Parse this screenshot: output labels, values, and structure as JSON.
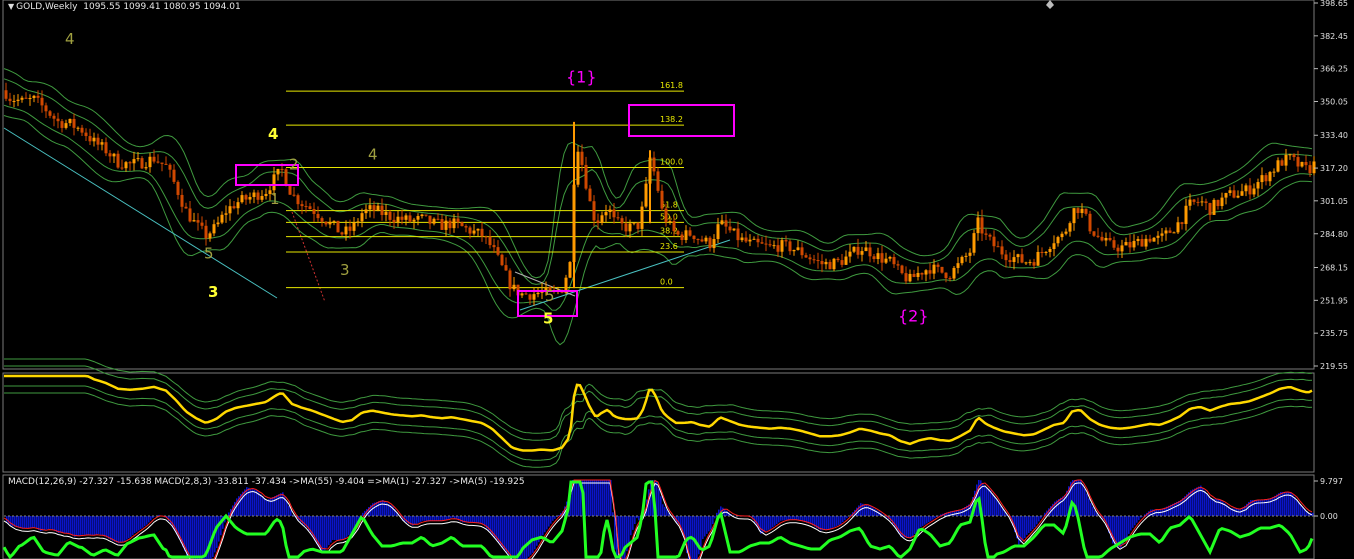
{
  "header": {
    "symbol": "GOLD,Weekly",
    "ohlc": "1095.55 1099.41 1080.95 1094.01"
  },
  "macd_header": {
    "text": "MACD(12,26,9) -27.327 -15.638  MACD(2,8,3) -33.811 -37.434  ->MA(55) -9.404  =>MA(1) -27.327  ->MA(5) -19.925"
  },
  "colors": {
    "background": "#000000",
    "candle_up": "#ff9a00",
    "candle_down": "#d04800",
    "band": "#3f9a3f",
    "fib": "#e8e800",
    "trendline": "#49c0c0",
    "highlight_box": "#ff00ff",
    "wave_yellow": "#ffff33",
    "wave_olive": "#a0a040",
    "wave_magenta": "#ff00ff",
    "osc_line": "#ffd800",
    "macd_hist": "#0a14c8",
    "macd_green": "#22ff22"
  },
  "chart_data": {
    "type": "candlestick",
    "timeframe": "Weekly",
    "price_axis": {
      "ticks": [
        "398.65",
        "382.45",
        "366.25",
        "350.05",
        "333.40",
        "317.20",
        "301.05",
        "284.80",
        "268.15",
        "251.95",
        "235.75",
        "219.55"
      ],
      "ylim": [
        219.55,
        398.65
      ]
    },
    "close_path_estimate": [
      [
        0,
        358
      ],
      [
        10,
        352
      ],
      [
        22,
        350
      ],
      [
        34,
        351
      ],
      [
        46,
        346
      ],
      [
        58,
        340
      ],
      [
        70,
        339
      ],
      [
        82,
        336
      ],
      [
        94,
        330
      ],
      [
        106,
        326
      ],
      [
        118,
        320
      ],
      [
        130,
        319
      ],
      [
        142,
        320
      ],
      [
        154,
        322
      ],
      [
        166,
        318
      ],
      [
        176,
        308
      ],
      [
        186,
        296
      ],
      [
        196,
        289
      ],
      [
        206,
        284
      ],
      [
        216,
        288
      ],
      [
        226,
        296
      ],
      [
        236,
        300
      ],
      [
        246,
        302
      ],
      [
        256,
        304
      ],
      [
        266,
        306
      ],
      [
        276,
        313
      ],
      [
        282,
        316
      ],
      [
        292,
        304
      ],
      [
        302,
        300
      ],
      [
        312,
        297
      ],
      [
        322,
        293
      ],
      [
        332,
        289
      ],
      [
        342,
        285
      ],
      [
        352,
        287
      ],
      [
        362,
        295
      ],
      [
        372,
        297
      ],
      [
        382,
        295
      ],
      [
        392,
        293
      ],
      [
        402,
        292
      ],
      [
        412,
        291
      ],
      [
        422,
        292
      ],
      [
        432,
        290
      ],
      [
        442,
        289
      ],
      [
        452,
        290
      ],
      [
        462,
        288
      ],
      [
        472,
        286
      ],
      [
        482,
        284
      ],
      [
        492,
        278
      ],
      [
        502,
        268
      ],
      [
        512,
        258
      ],
      [
        522,
        255
      ],
      [
        532,
        255
      ],
      [
        542,
        256
      ],
      [
        552,
        255
      ],
      [
        562,
        258
      ],
      [
        570,
        270
      ],
      [
        574,
        312
      ],
      [
        578,
        328
      ],
      [
        584,
        315
      ],
      [
        590,
        300
      ],
      [
        596,
        290
      ],
      [
        602,
        295
      ],
      [
        608,
        298
      ],
      [
        614,
        291
      ],
      [
        620,
        289
      ],
      [
        626,
        288
      ],
      [
        632,
        288
      ],
      [
        638,
        289
      ],
      [
        644,
        300
      ],
      [
        650,
        322
      ],
      [
        656,
        312
      ],
      [
        662,
        296
      ],
      [
        668,
        290
      ],
      [
        676,
        284
      ],
      [
        684,
        284
      ],
      [
        692,
        285
      ],
      [
        700,
        282
      ],
      [
        710,
        280
      ],
      [
        720,
        290
      ],
      [
        730,
        286
      ],
      [
        740,
        282
      ],
      [
        750,
        280
      ],
      [
        760,
        279
      ],
      [
        770,
        278
      ],
      [
        780,
        279
      ],
      [
        790,
        278
      ],
      [
        800,
        276
      ],
      [
        810,
        273
      ],
      [
        820,
        270
      ],
      [
        830,
        270
      ],
      [
        840,
        271
      ],
      [
        850,
        274
      ],
      [
        860,
        278
      ],
      [
        870,
        276
      ],
      [
        880,
        273
      ],
      [
        890,
        271
      ],
      [
        900,
        265
      ],
      [
        910,
        262
      ],
      [
        920,
        266
      ],
      [
        930,
        268
      ],
      [
        940,
        266
      ],
      [
        950,
        265
      ],
      [
        960,
        270
      ],
      [
        970,
        276
      ],
      [
        978,
        290
      ],
      [
        986,
        283
      ],
      [
        994,
        279
      ],
      [
        1004,
        275
      ],
      [
        1014,
        273
      ],
      [
        1024,
        271
      ],
      [
        1034,
        272
      ],
      [
        1044,
        277
      ],
      [
        1054,
        282
      ],
      [
        1064,
        284
      ],
      [
        1072,
        296
      ],
      [
        1080,
        298
      ],
      [
        1090,
        288
      ],
      [
        1100,
        282
      ],
      [
        1110,
        279
      ],
      [
        1120,
        278
      ],
      [
        1130,
        279
      ],
      [
        1140,
        281
      ],
      [
        1150,
        283
      ],
      [
        1160,
        282
      ],
      [
        1170,
        286
      ],
      [
        1180,
        291
      ],
      [
        1190,
        299
      ],
      [
        1200,
        301
      ],
      [
        1210,
        297
      ],
      [
        1220,
        301
      ],
      [
        1230,
        304
      ],
      [
        1240,
        305
      ],
      [
        1250,
        307
      ],
      [
        1260,
        311
      ],
      [
        1270,
        315
      ],
      [
        1280,
        320
      ],
      [
        1290,
        322
      ],
      [
        1300,
        318
      ],
      [
        1308,
        316
      ],
      [
        1314,
        319
      ]
    ],
    "fib_levels": [
      {
        "label": "161.8",
        "price": 355.2
      },
      {
        "label": "138.2",
        "price": 338.4
      },
      {
        "label": "100.0",
        "price": 317.5
      },
      {
        "label": "61.8",
        "price": 296.2
      },
      {
        "label": "50.0",
        "price": 290.4
      },
      {
        "label": "38.2",
        "price": 283.4
      },
      {
        "label": "23.6",
        "price": 275.8
      },
      {
        "label": "0.0",
        "price": 258.2
      }
    ],
    "wave_labels": [
      {
        "text": "4",
        "price": 378.5,
        "style": "olive"
      },
      {
        "text": "5",
        "price": 272.5,
        "style": "olive"
      },
      {
        "text": "3",
        "price": 253.5,
        "style": "yellow"
      },
      {
        "text": "4",
        "price": 331.5,
        "style": "yellow"
      },
      {
        "text": "1",
        "price": 299.5,
        "style": "olive"
      },
      {
        "text": "2",
        "price": 316.5,
        "style": "olive"
      },
      {
        "text": "4",
        "price": 321.5,
        "style": "olive"
      },
      {
        "text": "3",
        "price": 264.5,
        "style": "olive"
      },
      {
        "text": "5",
        "price": 251.5,
        "style": "olive"
      },
      {
        "text": "5",
        "price": 240.5,
        "style": "yellow"
      },
      {
        "text": "{1}",
        "price": 359.5,
        "style": "magenta"
      },
      {
        "text": "{2}",
        "price": 241.5,
        "style": "magenta"
      }
    ],
    "macd_axis": {
      "ticks": [
        "9.797",
        "0.00"
      ]
    }
  }
}
